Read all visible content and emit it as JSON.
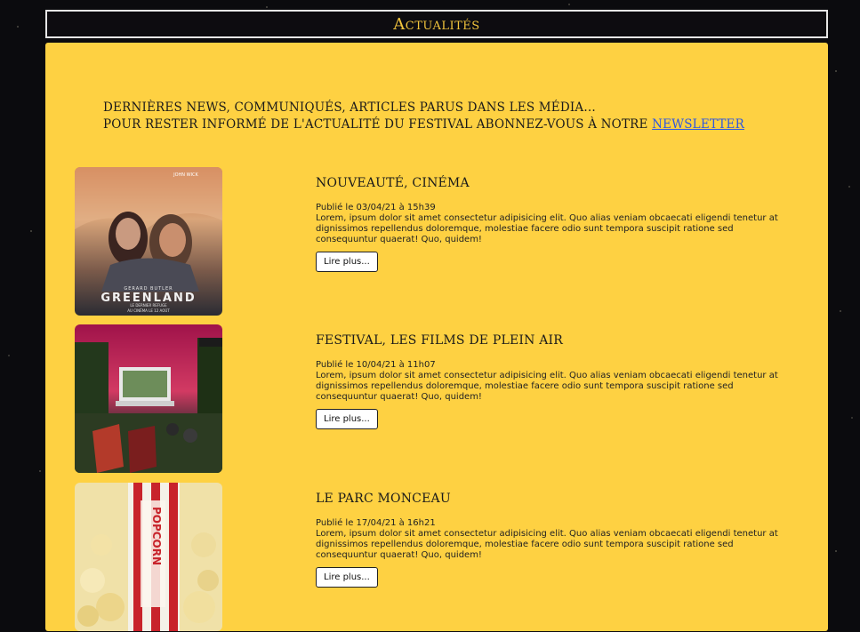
{
  "header": {
    "title": "Actualités"
  },
  "intro": {
    "line1": "Dernières news, communiqués, articles parus dans les média...",
    "line2_prefix": "Pour rester informé de l'actualité du festival abonnez-vous à notre ",
    "newsletter_link": "newsletter"
  },
  "articles": [
    {
      "title": "Nouveauté, cinéma",
      "date": "Publié le 03/04/21 à 15h39",
      "text": "Lorem, ipsum dolor sit amet consectetur adipisicing elit. Quo alias veniam obcaecati eligendi tenetur at dignissimos repellendus doloremque, molestiae facere odio sunt tempora suscipit ratione sed consequuntur quaerat! Quo, quidem!",
      "button": "Lire plus...",
      "image": "greenland-poster",
      "poster_title": "GREENLAND",
      "poster_top": "JOHN WICK",
      "poster_actor": "GERARD BUTLER",
      "poster_sub": "LE DERNIER REFUGE",
      "poster_date": "AU CINÉMA LE 12 AOÛT"
    },
    {
      "title": "Festival, les films de plein air",
      "date": "Publié le 10/04/21 à 11h07",
      "text": "Lorem, ipsum dolor sit amet consectetur adipisicing elit. Quo alias veniam obcaecati eligendi tenetur at dignissimos repellendus doloremque, molestiae facere odio sunt tempora suscipit ratione sed consequuntur quaerat! Quo, quidem!",
      "button": "Lire plus...",
      "image": "open-air-cinema"
    },
    {
      "title": "Le parc Monceau",
      "date": "Publié le 17/04/21 à 16h21",
      "text": "Lorem, ipsum dolor sit amet consectetur adipisicing elit. Quo alias veniam obcaecati eligendi tenetur at dignissimos repellendus doloremque, molestiae facere odio sunt tempora suscipit ratione sed consequuntur quaerat! Quo, quidem!",
      "button": "Lire plus...",
      "image": "popcorn",
      "popcorn_label": "POPCORN"
    }
  ],
  "colors": {
    "accent": "#fed142",
    "header_title": "#f2c53d",
    "link": "#2f57e0",
    "background": "#0b0b0e"
  }
}
